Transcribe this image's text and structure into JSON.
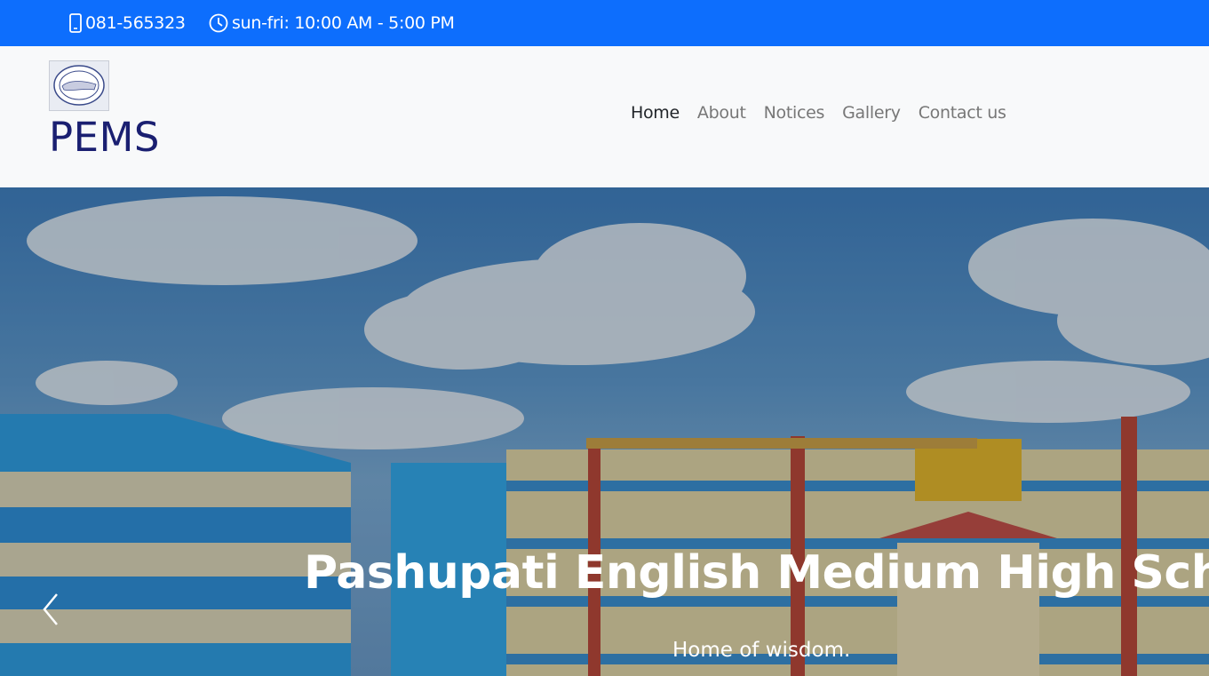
{
  "topbar": {
    "phone": "081-565323",
    "hours": "sun-fri: 10:00 AM - 5:00 PM",
    "phone_icon": "phone-icon",
    "clock_icon": "clock-icon",
    "bg_color": "#0d6efd"
  },
  "navbar": {
    "brand": "PEMS",
    "logo_icon": "school-logo",
    "links": [
      "Home",
      "About",
      "Notices",
      "Gallery",
      "Contact us"
    ],
    "active": "Home"
  },
  "hero": {
    "title": "Pashupati English Medium High School",
    "subtitle": "Home of wisdom.",
    "prev_icon": "chevron-left-icon"
  }
}
